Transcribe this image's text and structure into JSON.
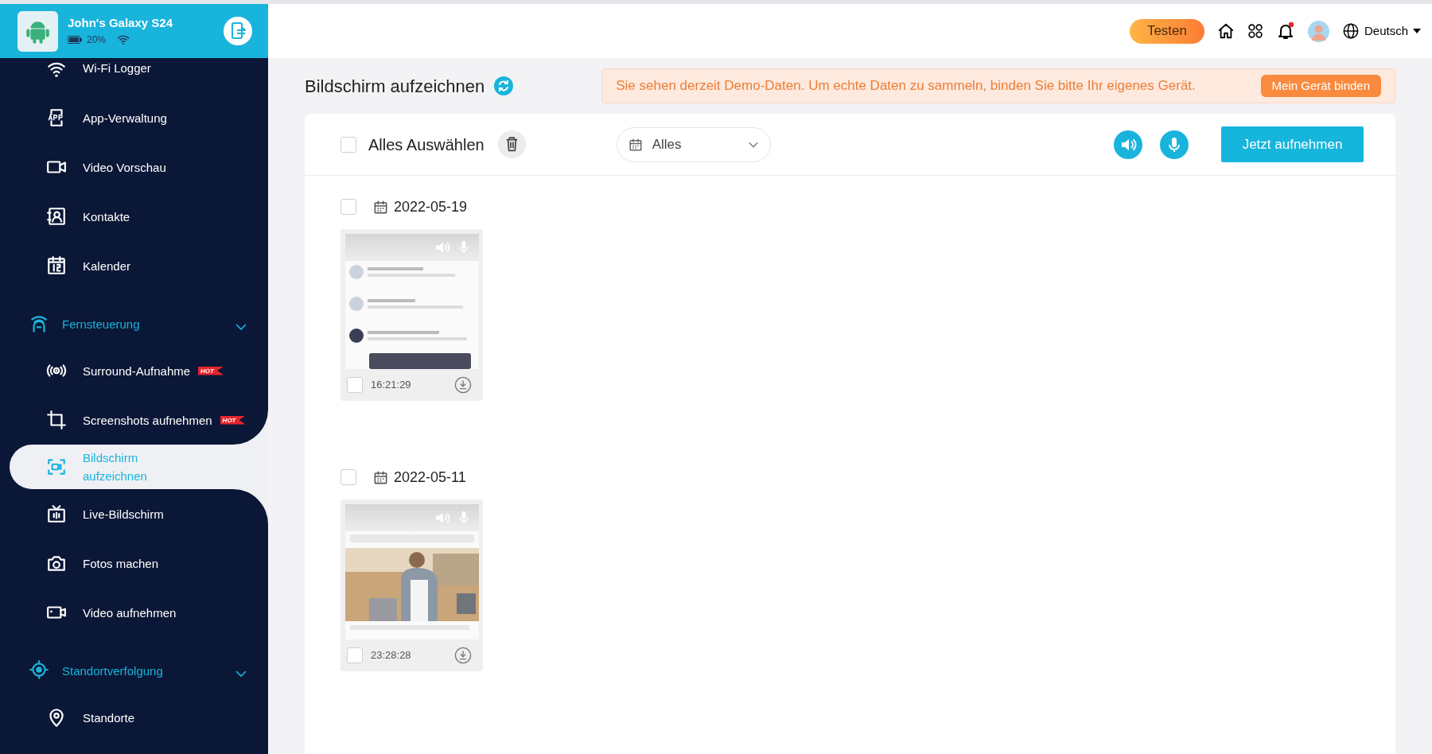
{
  "device": {
    "name": "John's Galaxy S24",
    "battery": "20%"
  },
  "sidebar": {
    "sections": [
      {
        "items": [
          {
            "label": "Wi-Fi Logger",
            "selected": false
          },
          {
            "label": "App-Verwaltung",
            "selected": false
          },
          {
            "label": "Video Vorschau",
            "selected": false
          },
          {
            "label": "Kontakte",
            "selected": false
          },
          {
            "label": "Kalender",
            "selected": false
          }
        ]
      },
      {
        "title": "Fernsteuerung",
        "expanded": true,
        "children": [
          {
            "label": "Surround-Aufnahme",
            "badge": "HOT",
            "selected": false
          },
          {
            "label": "Screenshots aufnehmen",
            "badge": "HOT",
            "selected": false
          },
          {
            "label": "Bildschirm aufzeichnen",
            "selected": true
          },
          {
            "label": "Live-Bildschirm",
            "selected": false
          },
          {
            "label": "Fotos machen",
            "selected": false
          },
          {
            "label": "Video aufnehmen",
            "selected": false
          }
        ]
      },
      {
        "title": "Standortverfolgung",
        "expanded": true,
        "children": [
          {
            "label": "Standorte",
            "selected": false
          }
        ]
      }
    ]
  },
  "topbar": {
    "trial_button": "Testen",
    "language": "Deutsch",
    "has_notification": true
  },
  "page_title": "Bildschirm aufzeichnen",
  "banner": {
    "message": "Sie sehen derzeit Demo-Daten. Um echte Daten zu sammeln, binden Sie bitte Ihr eigenes Gerät.",
    "button": "Mein Gerät binden"
  },
  "toolbar": {
    "select_all": {
      "label": "Alles Auswählen",
      "checked": false
    },
    "filter": "Alles",
    "record_button": "Jetzt aufnehmen"
  },
  "recordings": [
    {
      "date": "2022-05-19",
      "checked": false,
      "clips": [
        {
          "time": "16:21:29",
          "checked": false,
          "kind": "picture"
        }
      ]
    },
    {
      "date": "2022-05-11",
      "checked": false,
      "clips": [
        {
          "time": "23:28:28",
          "checked": false,
          "kind": "picture"
        }
      ]
    }
  ]
}
